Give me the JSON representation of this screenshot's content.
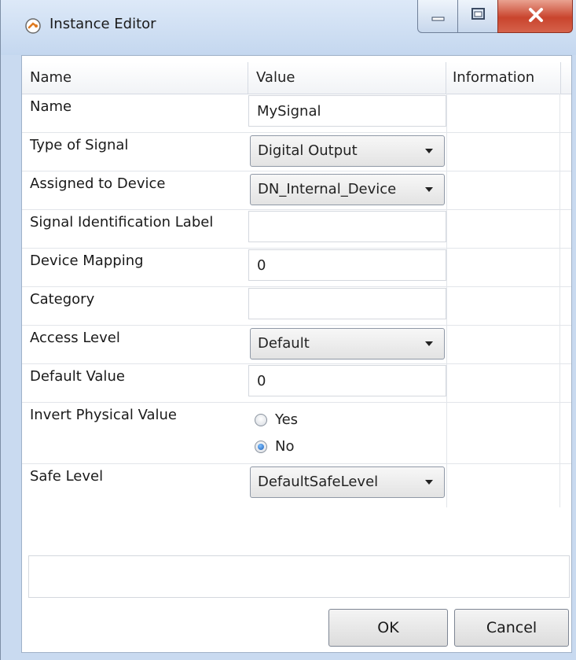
{
  "window": {
    "title": "Instance Editor",
    "icon": "robot-arm-icon",
    "controls": {
      "minimize": "minimize-icon",
      "maximize": "maximize-icon",
      "close": "close-icon"
    },
    "close_color": "#c9442d"
  },
  "grid": {
    "columns": [
      "Name",
      "Value",
      "Information"
    ],
    "rows": [
      {
        "label": "Name",
        "type": "text",
        "value": "MySignal"
      },
      {
        "label": "Type of Signal",
        "type": "combo",
        "value": "Digital Output"
      },
      {
        "label": "Assigned to Device",
        "type": "combo",
        "value": "DN_Internal_Device"
      },
      {
        "label": "Signal Identification Label",
        "type": "text",
        "value": ""
      },
      {
        "label": "Device Mapping",
        "type": "text",
        "value": "0"
      },
      {
        "label": "Category",
        "type": "text",
        "value": ""
      },
      {
        "label": "Access Level",
        "type": "combo",
        "value": "Default"
      },
      {
        "label": "Default Value",
        "type": "text",
        "value": "0"
      },
      {
        "label": "Invert Physical Value",
        "type": "radio",
        "options": [
          "Yes",
          "No"
        ],
        "selected": "No"
      },
      {
        "label": "Safe Level",
        "type": "combo",
        "value": "DefaultSafeLevel"
      }
    ]
  },
  "buttons": {
    "ok": "OK",
    "cancel": "Cancel"
  }
}
